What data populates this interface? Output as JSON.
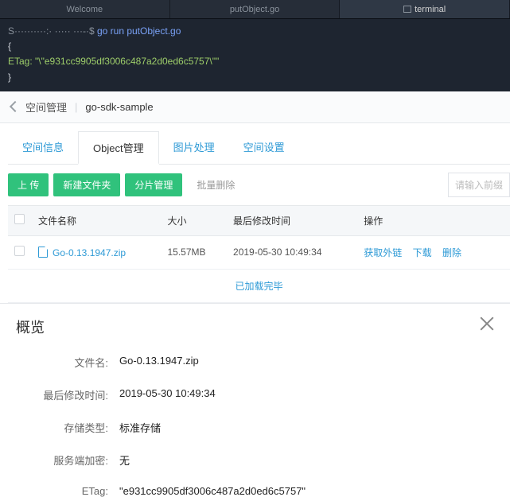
{
  "editor": {
    "tabs": {
      "welcome": "Welcome",
      "file": "putObject.go",
      "terminal": "terminal"
    },
    "prompt_host": "S··········:· ·····",
    "prompt_path": "···-·",
    "prompt_symbol": "$",
    "command": "go run putObject.go",
    "output_open": "{",
    "output_line": "  ETag: \"\\\"e931cc9905df3006c487a2d0ed6c5757\\\"\"",
    "output_close": "}"
  },
  "crumbs": {
    "space_mgmt": "空间管理",
    "bucket": "go-sdk-sample"
  },
  "subtabs": {
    "info": "空间信息",
    "object": "Object管理",
    "image": "图片处理",
    "settings": "空间设置"
  },
  "toolbar": {
    "upload": "上 传",
    "new_folder": "新建文件夹",
    "fragment": "分片管理",
    "batch_delete": "批量删除",
    "search_placeholder": "请输入前缀"
  },
  "table": {
    "cols": {
      "name": "文件名称",
      "size": "大小",
      "mtime": "最后修改时间",
      "ops": "操作"
    },
    "row": {
      "name": "Go-0.13.1947.zip",
      "size": "15.57MB",
      "mtime": "2019-05-30 10:49:34",
      "get_link": "获取外链",
      "download": "下载",
      "delete": "删除"
    },
    "loaded": "已加载完毕"
  },
  "overview": {
    "title": "概览",
    "labels": {
      "filename": "文件名:",
      "mtime": "最后修改时间:",
      "storage": "存储类型:",
      "sse": "服务端加密:",
      "etag": "ETag:"
    },
    "values": {
      "filename": "Go-0.13.1947.zip",
      "mtime": "2019-05-30 10:49:34",
      "storage": "标准存储",
      "sse": "无",
      "etag": "\"e931cc9905df3006c487a2d0ed6c5757\""
    }
  }
}
